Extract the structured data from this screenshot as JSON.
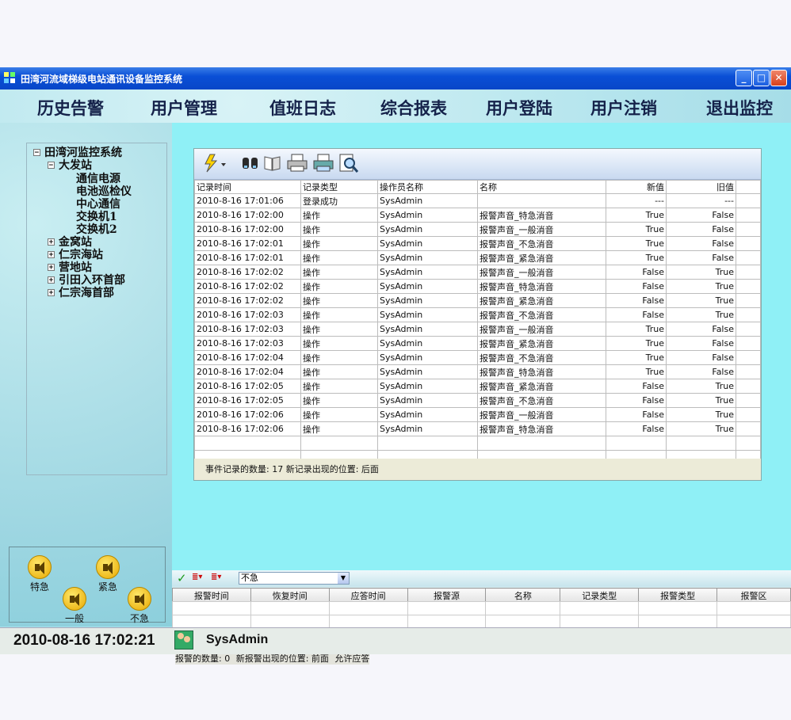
{
  "window": {
    "title": "田湾河流域梯级电站通讯设备监控系统"
  },
  "menu": {
    "items": [
      "历史告警",
      "用户管理",
      "值班日志",
      "综合报表",
      "用户登陆",
      "用户注销",
      "退出监控"
    ]
  },
  "tree": {
    "root": "田湾河监控系统",
    "station1": "大发站",
    "children1": [
      "通信电源",
      "电池巡检仪",
      "中心通信",
      "交换机1",
      "交换机2"
    ],
    "others": [
      "金窝站",
      "仁宗海站",
      "营地站",
      "引田入环首部",
      "仁宗海首部"
    ]
  },
  "alarm_buttons": {
    "special": "特急",
    "urgent": "紧急",
    "normal": "一般",
    "not_urgent": "不急"
  },
  "events": {
    "columns": [
      "记录时间",
      "记录类型",
      "操作员名称",
      "名称",
      "新值",
      "旧值"
    ],
    "rows": [
      [
        "2010-8-16 17:01:06",
        "登录成功",
        "SysAdmin",
        "",
        "---",
        "---"
      ],
      [
        "2010-8-16 17:02:00",
        "操作",
        "SysAdmin",
        "报警声音_特急消音",
        "True",
        "False"
      ],
      [
        "2010-8-16 17:02:00",
        "操作",
        "SysAdmin",
        "报警声音_一般消音",
        "True",
        "False"
      ],
      [
        "2010-8-16 17:02:01",
        "操作",
        "SysAdmin",
        "报警声音_不急消音",
        "True",
        "False"
      ],
      [
        "2010-8-16 17:02:01",
        "操作",
        "SysAdmin",
        "报警声音_紧急消音",
        "True",
        "False"
      ],
      [
        "2010-8-16 17:02:02",
        "操作",
        "SysAdmin",
        "报警声音_一般消音",
        "False",
        "True"
      ],
      [
        "2010-8-16 17:02:02",
        "操作",
        "SysAdmin",
        "报警声音_特急消音",
        "False",
        "True"
      ],
      [
        "2010-8-16 17:02:02",
        "操作",
        "SysAdmin",
        "报警声音_紧急消音",
        "False",
        "True"
      ],
      [
        "2010-8-16 17:02:03",
        "操作",
        "SysAdmin",
        "报警声音_不急消音",
        "False",
        "True"
      ],
      [
        "2010-8-16 17:02:03",
        "操作",
        "SysAdmin",
        "报警声音_一般消音",
        "True",
        "False"
      ],
      [
        "2010-8-16 17:02:03",
        "操作",
        "SysAdmin",
        "报警声音_紧急消音",
        "True",
        "False"
      ],
      [
        "2010-8-16 17:02:04",
        "操作",
        "SysAdmin",
        "报警声音_不急消音",
        "True",
        "False"
      ],
      [
        "2010-8-16 17:02:04",
        "操作",
        "SysAdmin",
        "报警声音_特急消音",
        "True",
        "False"
      ],
      [
        "2010-8-16 17:02:05",
        "操作",
        "SysAdmin",
        "报警声音_紧急消音",
        "False",
        "True"
      ],
      [
        "2010-8-16 17:02:05",
        "操作",
        "SysAdmin",
        "报警声音_不急消音",
        "False",
        "True"
      ],
      [
        "2010-8-16 17:02:06",
        "操作",
        "SysAdmin",
        "报警声音_一般消音",
        "False",
        "True"
      ],
      [
        "2010-8-16 17:02:06",
        "操作",
        "SysAdmin",
        "报警声音_特急消音",
        "False",
        "True"
      ]
    ],
    "status": "事件记录的数量: 17  新记录出现的位置: 后面"
  },
  "alarms": {
    "filter_value": "不急",
    "columns": [
      "报警时间",
      "恢复时间",
      "应答时间",
      "报警源",
      "名称",
      "记录类型",
      "报警类型",
      "报警区"
    ],
    "status_count": "报警的数量: 0",
    "status_position": "新报警出现的位置: 前面",
    "status_answer": "允许应答"
  },
  "footer": {
    "datetime": "2010-08-16 17:02:21",
    "user": "SysAdmin"
  },
  "colors": {
    "titlebar": "#0a4fd6",
    "main_bg": "#8ff0f6",
    "panel_bg": "#a8e2ec"
  }
}
